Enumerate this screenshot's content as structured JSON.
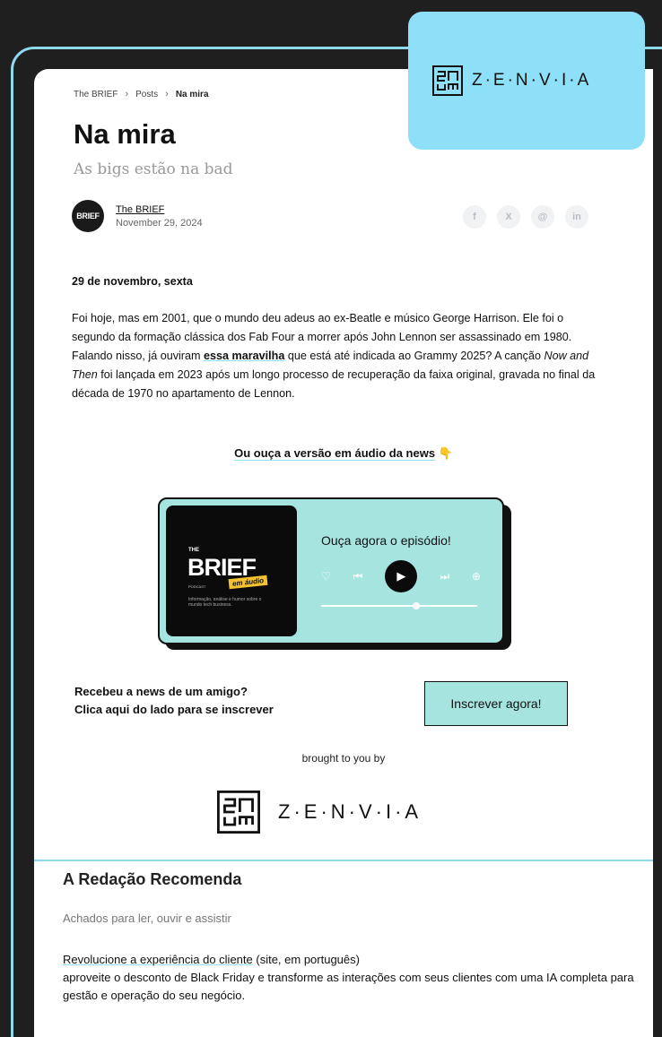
{
  "breadcrumb": {
    "items": [
      "The BRIEF",
      "Posts"
    ],
    "current": "Na mira"
  },
  "post": {
    "title": "Na mira",
    "subtitle": "As bigs estão na bad"
  },
  "author": {
    "avatar_text": "BRIEF",
    "name": "The BRIEF",
    "date": "November 29, 2024"
  },
  "share": {
    "icons": [
      "facebook-icon",
      "x-icon",
      "threads-icon",
      "linkedin-icon"
    ],
    "labels": [
      "f",
      "X",
      "@",
      "in"
    ]
  },
  "body": {
    "date_heading": "29 de novembro, sexta",
    "p1_a": "Foi hoje, mas em 2001, que o mundo deu adeus ao ex-Beatle e músico George Harrison. Ele foi o segundo da formação clássica dos Fab Four a morrer após John Lennon ser assassinado em 1980. Falando nisso, já ouviram ",
    "p1_link": "essa maravilha",
    "p1_b": " que está até indicada ao Grammy 2025? A canção ",
    "p1_italic": "Now and Then",
    "p1_c": " foi lançada em 2023 após um longo processo de recuperação da faixa original, gravada no final da década de 1970 no apartamento de Lennon."
  },
  "audio_cta": {
    "text": "Ou ouça a versão em áudio da news",
    "emoji": "👇"
  },
  "player": {
    "title": "Ouça agora o episódio!",
    "cover": {
      "the": "THE",
      "brand": "BRIEF",
      "tag": "em áudio",
      "kind": "PODCAST",
      "desc": "Informação, análise e humor sobre o mundo tech business."
    },
    "progress": 0.6
  },
  "subscribe": {
    "line1": "Recebeu a news de um amigo?",
    "line2": "Clica aqui do lado para se inscrever",
    "button": "Inscrever agora!"
  },
  "sponsor": {
    "brought": "brought to you by",
    "brand": "Z·E·N·V·I·A"
  },
  "logo_badge": {
    "brand": "Z·E·N·V·I·A"
  },
  "recommends": {
    "title": "A Redação Recomenda",
    "subtitle": "Achados para ler, ouvir e assistir",
    "item_link": "Revolucione a experiência do cliente",
    "item_note": " (site, em português)",
    "item_desc": "aproveite o desconto de Black Friday e transforme as interações com seus clientes com uma IA completa para gestão e operação do seu negócio."
  },
  "colors": {
    "accent": "#8ee0f8",
    "player_bg": "#a6e4e0",
    "page_bg": "#1f1f1f"
  }
}
